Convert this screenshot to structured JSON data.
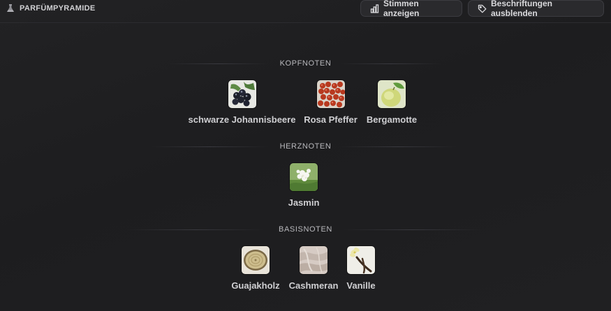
{
  "header": {
    "title": "PARFÜMPYRAMIDE",
    "title_icon": "flask-icon",
    "votes_button": {
      "label": "Stimmen anzeigen",
      "icon": "bar-chart-icon"
    },
    "labels_button": {
      "label": "Beschriftungen ausblenden",
      "icon": "tag-icon"
    }
  },
  "pyramid": {
    "top": {
      "title": "KOPFNOTEN",
      "notes": [
        {
          "label": "schwarze Johannisbeere",
          "icon": "blackcurrant-image"
        },
        {
          "label": "Rosa Pfeffer",
          "icon": "pink-pepper-image"
        },
        {
          "label": "Bergamotte",
          "icon": "bergamot-image"
        }
      ]
    },
    "heart": {
      "title": "HERZNOTEN",
      "notes": [
        {
          "label": "Jasmin",
          "icon": "jasmine-image"
        }
      ]
    },
    "base": {
      "title": "BASISNOTEN",
      "notes": [
        {
          "label": "Guajakholz",
          "icon": "guaiac-wood-image"
        },
        {
          "label": "Cashmeran",
          "icon": "cashmeran-image"
        },
        {
          "label": "Vanille",
          "icon": "vanilla-image"
        }
      ]
    }
  },
  "colors": {
    "background": "#1f1f21",
    "button_bg": "#2a2a2d",
    "button_border": "#3c3c41",
    "text": "#cfcfd2"
  }
}
